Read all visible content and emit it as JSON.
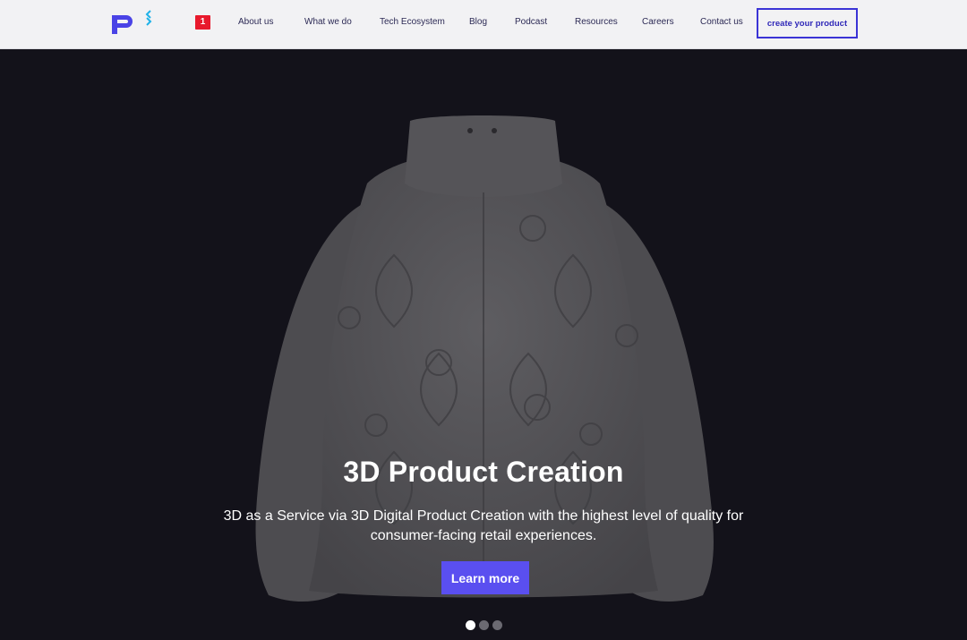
{
  "brand": {
    "accent": "#5a4ff0",
    "logo_icon": "p-logo-icon"
  },
  "nav": {
    "badge": "1",
    "links": [
      "About us",
      "What we do",
      "Tech Ecosystem",
      "Blog",
      "Podcast",
      "Resources",
      "Careers",
      "Contact us"
    ],
    "cta": "create your product"
  },
  "hero": {
    "image": "quilted-puffer-jacket",
    "title": "3D Product Creation",
    "subtitle": "3D as a Service via 3D Digital Product Creation with the highest level of quality for consumer-facing retail experiences.",
    "button": "Learn more",
    "carousel": {
      "slides": 3,
      "active": 1
    }
  }
}
